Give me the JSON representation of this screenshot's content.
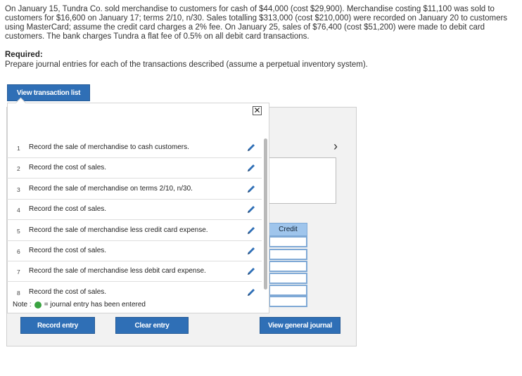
{
  "problem": {
    "text": "On January 15, Tundra Co. sold merchandise to customers for cash of $44,000 (cost $29,900). Merchandise costing $11,100 was sold to customers for $16,600 on January 17; terms 2/10, n/30. Sales totalling $313,000 (cost $210,000) were recorded on January 20 to customers using MasterCard; assume the credit card charges a 2% fee. On January 25, sales of $76,400 (cost $51,200) were made to debit card customers. The bank charges Tundra a flat fee of 0.5% on all debit card transactions."
  },
  "required": {
    "title": "Required:",
    "text": "Prepare journal entries for each of the transactions described (assume a perpetual inventory system)."
  },
  "buttons": {
    "view_transaction_list": "View transaction list",
    "record_entry": "Record entry",
    "clear_entry": "Clear entry",
    "view_general_journal": "View general journal"
  },
  "popup": {
    "close_symbol": "✕",
    "transactions": [
      {
        "num": "1",
        "label": "Record the sale of merchandise to cash customers."
      },
      {
        "num": "2",
        "label": "Record the cost of sales."
      },
      {
        "num": "3",
        "label": "Record the sale of merchandise on terms 2/10, n/30."
      },
      {
        "num": "4",
        "label": "Record the cost of sales."
      },
      {
        "num": "5",
        "label": "Record the sale of merchandise less credit card expense."
      },
      {
        "num": "6",
        "label": "Record the cost of sales."
      },
      {
        "num": "7",
        "label": "Record the sale of merchandise less debit card expense."
      },
      {
        "num": "8",
        "label": "Record the cost of sales."
      }
    ],
    "note_label": "Note :",
    "note_text": "= journal entry has been entered"
  },
  "journal": {
    "credit_header": "Credit",
    "next_symbol": "›"
  },
  "colors": {
    "button_blue": "#2f6fb6",
    "entered_green": "#3aa341",
    "credit_header_bg": "#9fc5ec"
  },
  "icons": {
    "edit": "pencil-icon",
    "close": "close-icon",
    "next": "chevron-right-icon"
  }
}
